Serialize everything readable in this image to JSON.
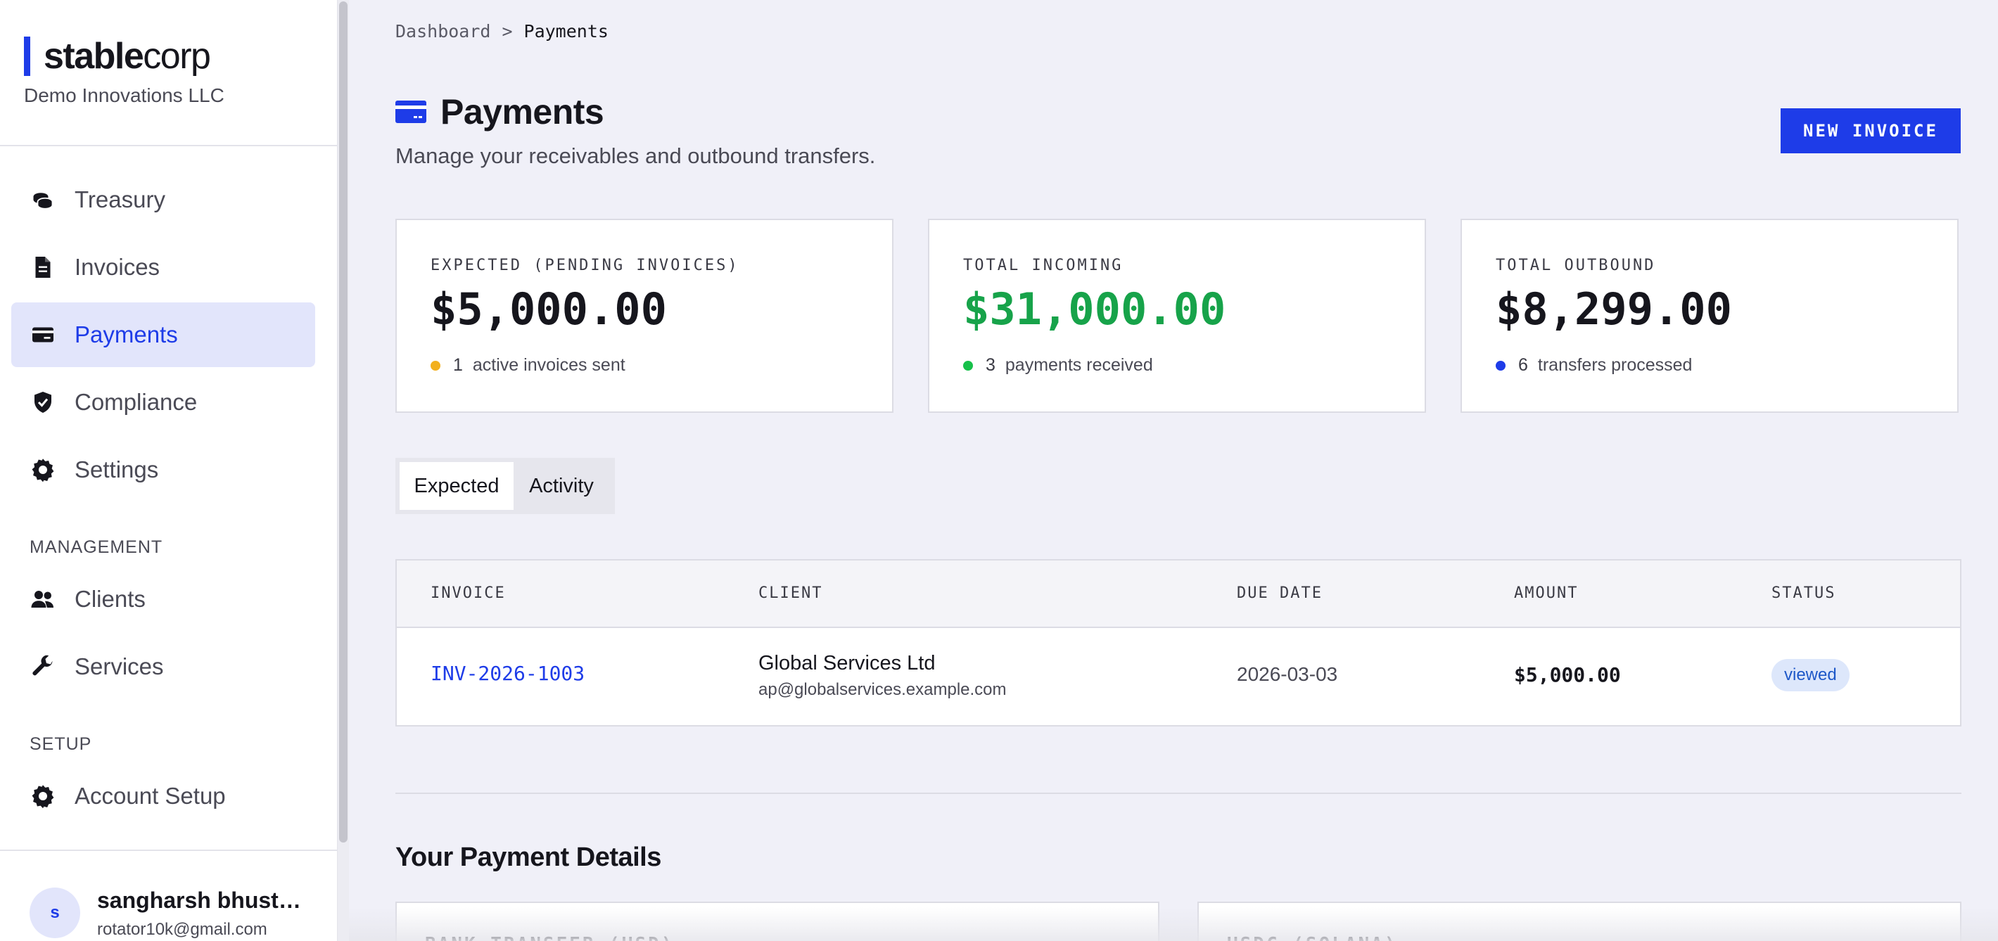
{
  "brand": {
    "name_bold": "stable",
    "name_light": "corp",
    "org": "Demo Innovations LLC",
    "accent": "#1e3ce8"
  },
  "sidebar": {
    "items": [
      {
        "label": "Treasury",
        "icon": "coins-icon"
      },
      {
        "label": "Invoices",
        "icon": "document-icon"
      },
      {
        "label": "Payments",
        "icon": "credit-card-icon",
        "active": true
      },
      {
        "label": "Compliance",
        "icon": "shield-check-icon"
      },
      {
        "label": "Settings",
        "icon": "gear-icon"
      }
    ],
    "management_label": "MANAGEMENT",
    "management_items": [
      {
        "label": "Clients",
        "icon": "users-icon"
      },
      {
        "label": "Services",
        "icon": "wrench-icon"
      }
    ],
    "setup_label": "SETUP",
    "setup_items": [
      {
        "label": "Account Setup",
        "icon": "gear-icon"
      }
    ],
    "user": {
      "initial": "s",
      "name": "sangharsh bhustalimath",
      "email": "rotator10k@gmail.com"
    }
  },
  "breadcrumb": {
    "root": "Dashboard",
    "separator": ">",
    "current": "Payments"
  },
  "header": {
    "title": "Payments",
    "subtitle": "Manage your receivables and outbound transfers.",
    "new_invoice_label": "NEW INVOICE"
  },
  "cards": [
    {
      "label": "EXPECTED (PENDING INVOICES)",
      "value": "$5,000.00",
      "count": "1",
      "note": "active invoices sent",
      "dot_color": "#f2b01e"
    },
    {
      "label": "TOTAL INCOMING",
      "value": "$31,000.00",
      "count": "3",
      "note": "payments received",
      "dot_color": "#17c04a",
      "value_color": "#17a34a"
    },
    {
      "label": "TOTAL OUTBOUND",
      "value": "$8,299.00",
      "count": "6",
      "note": "transfers processed",
      "dot_color": "#1e3ce8"
    }
  ],
  "tabs": [
    {
      "label": "Expected",
      "active": true
    },
    {
      "label": "Activity",
      "active": false
    }
  ],
  "table": {
    "headers": [
      "INVOICE",
      "CLIENT",
      "DUE DATE",
      "AMOUNT",
      "STATUS"
    ],
    "rows": [
      {
        "invoice": "INV-2026-1003",
        "client_name": "Global Services Ltd",
        "client_email": "ap@globalservices.example.com",
        "due_date": "2026-03-03",
        "amount": "$5,000.00",
        "status": "viewed"
      }
    ]
  },
  "payment_details": {
    "title": "Your Payment Details",
    "cards": [
      "BANK TRANSFER (USD)",
      "USDC (SOLANA)"
    ]
  }
}
